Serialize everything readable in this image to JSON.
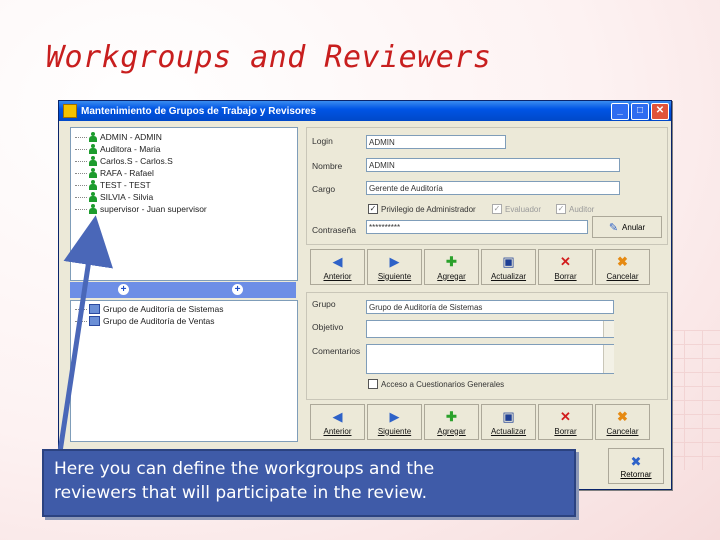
{
  "slide": {
    "title": "Workgroups and Reviewers"
  },
  "window": {
    "title": "Mantenimiento de Grupos de Trabajo y Revisores",
    "min_label": "_",
    "max_label": "□",
    "close_label": "✕"
  },
  "users_tree": [
    "ADMIN - ADMIN",
    "Auditora - Maria",
    "Carlos.S - Carlos.S",
    "RAFA - Rafael",
    "TEST - TEST",
    "SILVIA - Silvia",
    "supervisor - Juan supervisor"
  ],
  "groups_list": [
    "Grupo de Auditoría de Sistemas",
    "Grupo de Auditoría de Ventas"
  ],
  "user_form": {
    "login_label": "Login",
    "login_value": "ADMIN",
    "name_label": "Nombre",
    "name_value": "ADMIN",
    "role_label": "Cargo",
    "role_value": "Gerente de Auditoría",
    "chk_admin": "Privilegio de Administrador",
    "chk_eval": "Evaluador",
    "chk_auditor": "Auditor",
    "password_label": "Contraseña",
    "password_value": "**********",
    "anular_label": "Anular"
  },
  "group_form": {
    "group_label": "Grupo",
    "group_value": "Grupo de Auditoría de Sistemas",
    "objective_label": "Objetivo",
    "comments_label": "Comentarios",
    "chk_access": "Acceso a Cuestionarios Generales"
  },
  "toolbar": {
    "anterior": "Anterior",
    "siguiente": "Siguiente",
    "agregar": "Agregar",
    "actualizar": "Actualizar",
    "borrar": "Borrar",
    "cancelar": "Cancelar",
    "retornar": "Retornar"
  },
  "callout": {
    "line1": "Here you can define the workgroups and the",
    "line2": "reviewers that will participate in the review."
  }
}
